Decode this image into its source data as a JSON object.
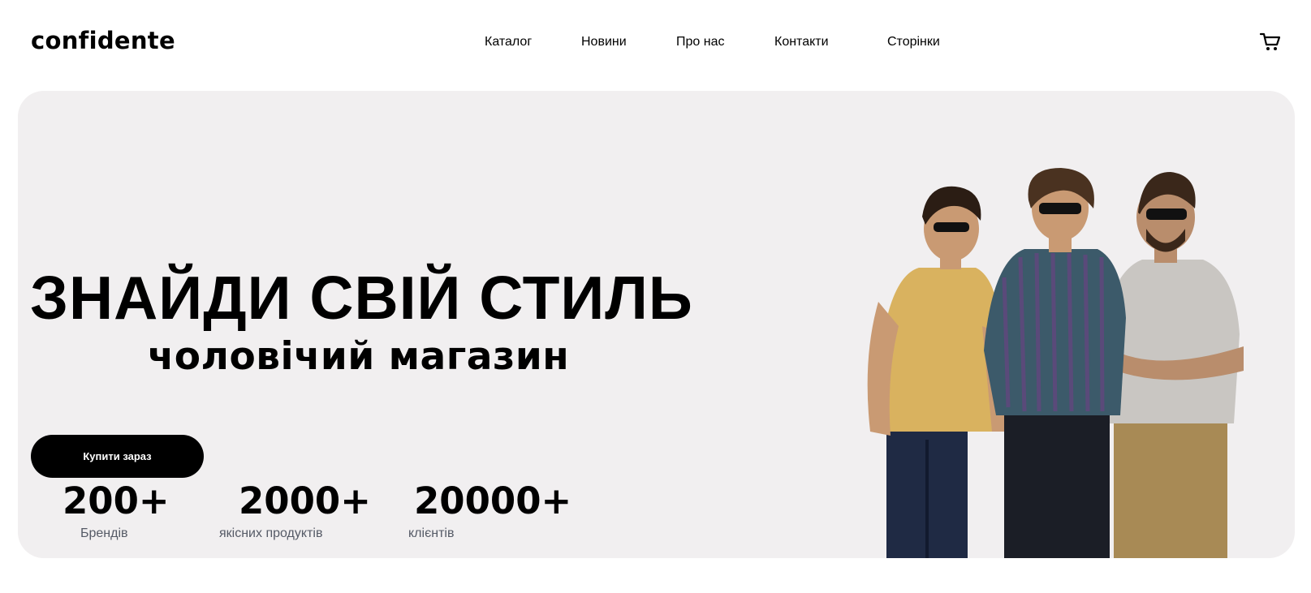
{
  "header": {
    "logo": "confidente",
    "nav": [
      "Каталог",
      "Новини",
      "Про нас",
      "Контакти",
      "Сторінки"
    ],
    "cart_icon": "shopping-cart-icon"
  },
  "hero": {
    "headline": "ЗНАЙДИ СВІЙ СТИЛЬ",
    "subheadline": "чоловічий магазин",
    "cta_label": "Купити зараз",
    "stats": [
      {
        "value": "200+",
        "label": "Брендів"
      },
      {
        "value": "2000+",
        "label": "якісних продуктів"
      },
      {
        "value": "20000+",
        "label": "клієнтів"
      }
    ],
    "image": "three-men-in-sunglasses-photo"
  },
  "colors": {
    "hero_background": "#f1eff0",
    "button_background": "#000000",
    "button_text": "#ffffff",
    "stat_label": "#555a66"
  }
}
